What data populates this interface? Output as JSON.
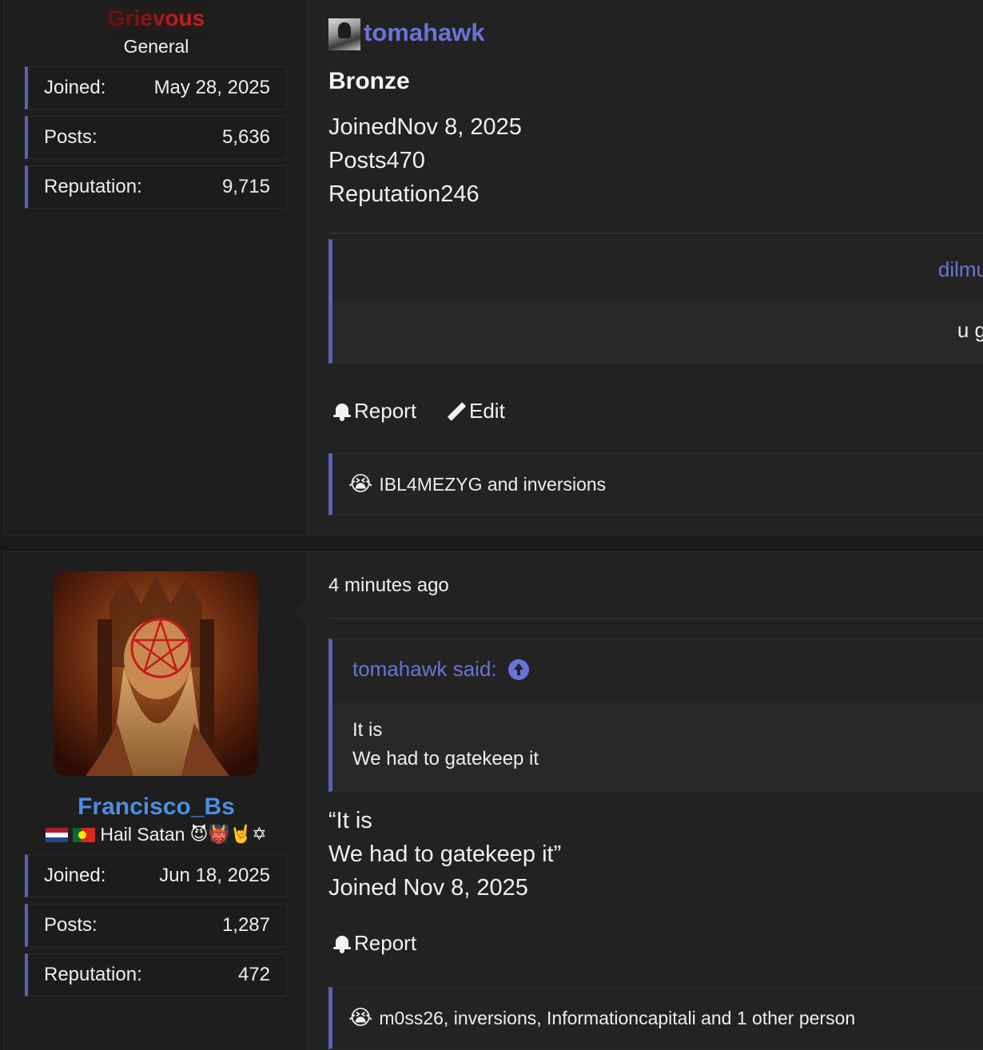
{
  "post1": {
    "user": {
      "name": "Grievous",
      "title": "General",
      "stats": [
        {
          "label": "Joined:",
          "value": "May 28, 2025"
        },
        {
          "label": "Posts:",
          "value": "5,636"
        },
        {
          "label": "Reputation:",
          "value": "9,715"
        }
      ]
    },
    "content": {
      "author": "tomahawk",
      "rank": "Bronze",
      "joined": "JoinedNov 8, 2025",
      "posts": "Posts470",
      "reputation": "Reputation246",
      "quote_author": "dilmu",
      "quote_text": "u g",
      "report_label": "Report",
      "edit_label": "Edit",
      "reaction_emoji": "😭",
      "reactions_text": "IBL4MEZYG and inversions"
    }
  },
  "post2": {
    "user": {
      "name": "Francisco_Bs",
      "title": "Hail Satan",
      "title_emojis": "😈👹🤘✡",
      "stats": [
        {
          "label": "Joined:",
          "value": "Jun 18, 2025"
        },
        {
          "label": "Posts:",
          "value": "1,287"
        },
        {
          "label": "Reputation:",
          "value": "472"
        }
      ]
    },
    "content": {
      "timestamp": "4 minutes ago",
      "quote_header": "tomahawk said:",
      "quote_line1": "It is",
      "quote_line2": "We had to gatekeep it",
      "reply_line1": "“It is",
      "reply_line2": "We had to gatekeep it”",
      "reply_line3": "Joined Nov 8, 2025",
      "report_label": "Report",
      "reaction_emoji": "😭",
      "reactions_text": "m0ss26, inversions, Informationcapitali and 1 other person"
    }
  },
  "colors": {
    "accent": "#5b63b8",
    "link": "#6b73d6",
    "username_blue": "#4a8fe0",
    "rank_red": "#c62424"
  }
}
